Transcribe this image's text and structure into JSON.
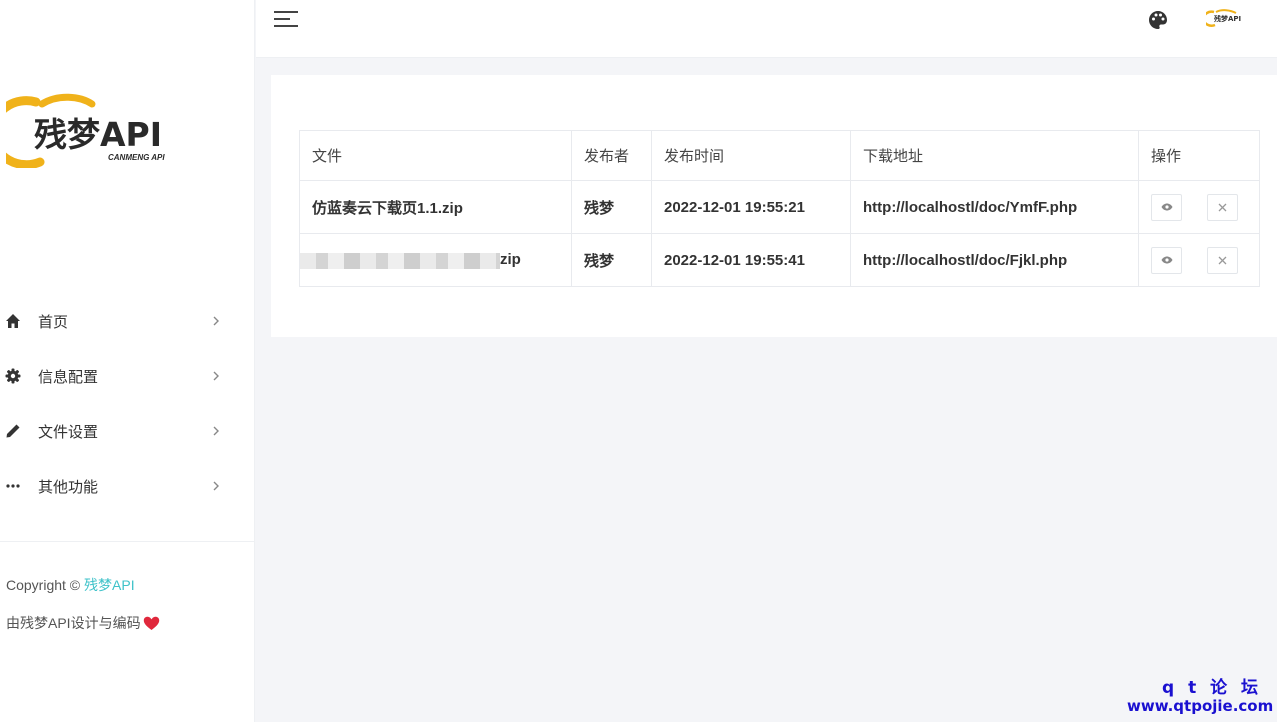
{
  "sidebar": {
    "logo": {
      "text": "残梦API",
      "subtext": "CANMENG API"
    },
    "items": [
      {
        "label": "首页",
        "icon": "home-icon"
      },
      {
        "label": "信息配置",
        "icon": "gear-icon"
      },
      {
        "label": "文件设置",
        "icon": "pencil-icon"
      },
      {
        "label": "其他功能",
        "icon": "more-icon"
      }
    ],
    "copyright_prefix": "Copyright ©",
    "copyright_brand": "残梦API",
    "credit": "由残梦API设计与编码"
  },
  "header": {
    "avatar_text": "残梦API"
  },
  "table": {
    "headers": [
      "文件",
      "发布者",
      "发布时间",
      "下载地址",
      "操作"
    ],
    "rows": [
      {
        "file": "仿蓝奏云下载页1.1.zip",
        "publisher": "残梦",
        "time": "2022-12-01 19:55:21",
        "url": "http://localhostl/doc/YmfF.php"
      },
      {
        "file": "zip",
        "publisher": "残梦",
        "time": "2022-12-01 19:55:41",
        "url": "http://localhostl/doc/Fjkl.php"
      }
    ]
  },
  "watermark": {
    "line1": "q t 论 坛",
    "line2": "www.qtpojie.com"
  },
  "colors": {
    "accent": "#3ec2c9",
    "heart": "#e0283c",
    "watermark": "#1a10d0"
  }
}
